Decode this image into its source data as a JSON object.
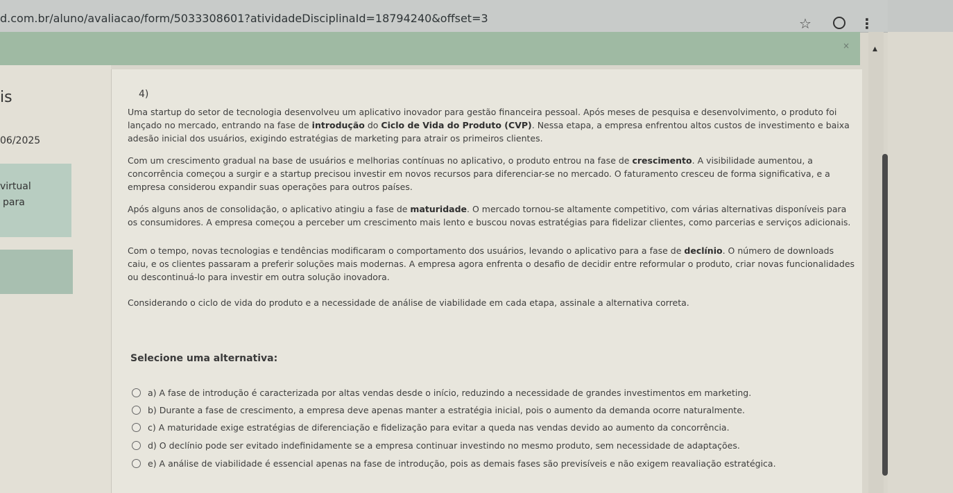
{
  "browser": {
    "url": "d.com.br/aluno/avaliacao/form/5033308601?atividadeDisciplinaId=18794240&offset=3"
  },
  "banner": {
    "close_glyph": "×"
  },
  "sidebar": {
    "title_fragment": "is",
    "date_fragment": "06/2025",
    "virtual_fragment": "virtual",
    "para_fragment": "para"
  },
  "question": {
    "number": "4)",
    "p1_a": "Uma startup do setor de tecnologia desenvolveu um aplicativo inovador para gestão financeira pessoal. Após meses de pesquisa e desenvolvimento, o produto foi lançado no mercado, entrando na fase de ",
    "p1_b1": "introdução",
    "p1_c": " do ",
    "p1_b2": "Ciclo de Vida do Produto (CVP)",
    "p1_d": ". Nessa etapa, a empresa enfrentou altos custos de investimento e baixa adesão inicial dos usuários, exigindo estratégias de marketing para atrair os primeiros clientes.",
    "p2_a": "Com um crescimento gradual na base de usuários e melhorias contínuas no aplicativo, o produto entrou na fase de ",
    "p2_b": "crescimento",
    "p2_c": ". A visibilidade aumentou, a concorrência começou a surgir e a startup precisou investir em novos recursos para diferenciar-se no mercado. O faturamento cresceu de forma significativa, e a empresa considerou expandir suas operações para outros países.",
    "p3_a": "Após alguns anos de consolidação, o aplicativo atingiu a fase de ",
    "p3_b": "maturidade",
    "p3_c": ". O mercado tornou-se altamente competitivo, com várias alternativas disponíveis para os consumidores. A empresa começou a perceber um crescimento mais lento e buscou novas estratégias para fidelizar clientes, como parcerias e serviços adicionais.",
    "p4_a": "Com o tempo, novas tecnologias e tendências modificaram o comportamento dos usuários, levando o aplicativo para a fase de ",
    "p4_b": "declínio",
    "p4_c": ". O número de downloads caiu, e os clientes passaram a preferir soluções mais modernas. A empresa agora enfrenta o desafio de decidir entre reformular o produto, criar novas funcionalidades ou descontinuá-lo para investir em outra solução inovadora.",
    "p5": "Considerando o ciclo de vida do produto e a necessidade de análise de viabilidade em cada etapa, assinale a alternativa correta.",
    "select_title": "Selecione uma alternativa:",
    "options": [
      "a) A fase de introdução é caracterizada por altas vendas desde o início, reduzindo a necessidade de grandes investimentos em marketing.",
      "b) Durante a fase de crescimento, a empresa deve apenas manter a estratégia inicial, pois o aumento da demanda ocorre naturalmente.",
      "c) A maturidade exige estratégias de diferenciação e fidelização para evitar a queda nas vendas devido ao aumento da concorrência.",
      "d) O declínio pode ser evitado indefinidamente se a empresa continuar investindo no mesmo produto, sem necessidade de adaptações.",
      "e) A análise de viabilidade é essencial apenas na fase de introdução, pois as demais fases são previsíveis e não exigem reavaliação estratégica."
    ]
  },
  "icons": {
    "star": "☆",
    "kebab": "⋮",
    "scroll_up": "▲"
  }
}
